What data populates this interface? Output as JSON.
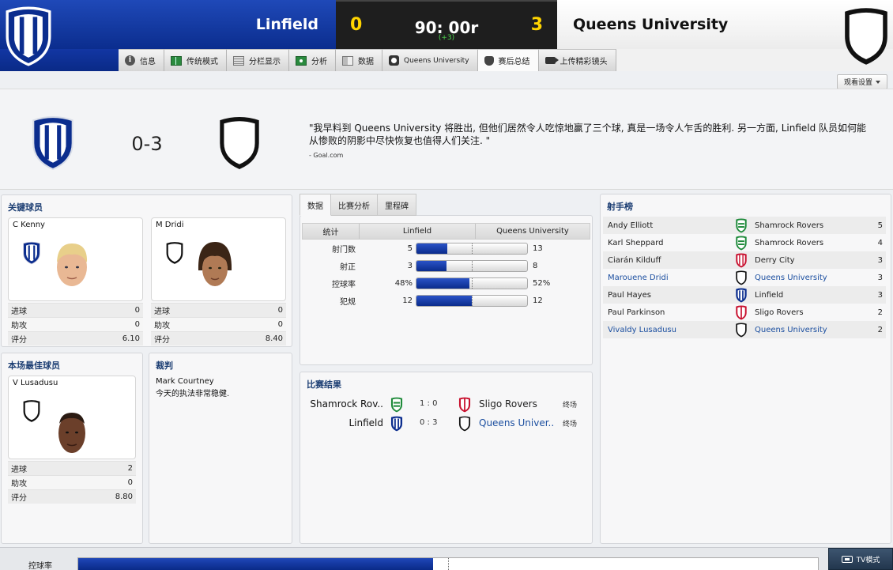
{
  "header": {
    "home_team": "Linfield",
    "away_team": "Queens University",
    "home_score": "0",
    "away_score": "3",
    "clock": "90: 00r",
    "added_time": "(+3)"
  },
  "tabs": [
    {
      "label": "信息",
      "icon": "info-icon"
    },
    {
      "label": "传统模式",
      "icon": "pitch-icon"
    },
    {
      "label": "分栏显示",
      "icon": "split-view-icon"
    },
    {
      "label": "分析",
      "icon": "analysis-icon"
    },
    {
      "label": "数据",
      "icon": "data-icon"
    },
    {
      "label": "Queens University",
      "icon": "club-icon"
    },
    {
      "label": "赛后总结",
      "icon": "shield-icon",
      "active": true
    },
    {
      "label": "上传精彩镜头",
      "icon": "camera-icon"
    }
  ],
  "view_settings": "观看设置",
  "summary": {
    "score": "0-3",
    "quote": "\"我早料到 Queens University 将胜出, 但他们居然令人吃惊地赢了三个球, 真是一场令人乍舌的胜利. 另一方面, Linfield 队员如何能从惨败的阴影中尽快恢复也值得人们关注. \"",
    "source": "- Goal.com"
  },
  "key_players": {
    "title": "关键球员",
    "players": [
      {
        "name": "C Kenny",
        "team": "home",
        "stats": [
          {
            "label": "进球",
            "value": "0"
          },
          {
            "label": "助攻",
            "value": "0"
          },
          {
            "label": "评分",
            "value": "6.10"
          }
        ]
      },
      {
        "name": "M Dridi",
        "team": "away",
        "stats": [
          {
            "label": "进球",
            "value": "0"
          },
          {
            "label": "助攻",
            "value": "0"
          },
          {
            "label": "评分",
            "value": "8.40"
          }
        ]
      }
    ]
  },
  "motm": {
    "title": "本场最佳球员",
    "name": "V Lusadusu",
    "stats": [
      {
        "label": "进球",
        "value": "2"
      },
      {
        "label": "助攻",
        "value": "0"
      },
      {
        "label": "评分",
        "value": "8.80"
      }
    ]
  },
  "referee": {
    "title": "裁判",
    "name": "Mark Courtney",
    "comment": "今天的执法非常稳健."
  },
  "stats_panel": {
    "subtabs": [
      "数据",
      "比赛分析",
      "里程碑"
    ],
    "headers": [
      "统计",
      "Linfield",
      "Queens University"
    ],
    "rows": [
      {
        "label": "射门数",
        "home": "5",
        "away": "13",
        "home_share": 0.278
      },
      {
        "label": "射正",
        "home": "3",
        "away": "8",
        "home_share": 0.273
      },
      {
        "label": "控球率",
        "home": "48%",
        "away": "52%",
        "home_share": 0.48
      },
      {
        "label": "犯规",
        "home": "12",
        "away": "12",
        "home_share": 0.5
      }
    ]
  },
  "results": {
    "title": "比赛结果",
    "rows": [
      {
        "home": "Shamrock Rov..",
        "home_club": "shamrock",
        "score": "1 : 0",
        "away": "Sligo Rovers",
        "away_club": "sligo",
        "status": "终场",
        "away_link": false
      },
      {
        "home": "Linfield",
        "home_club": "linfield",
        "score": "0 : 3",
        "away": "Queens Univer..",
        "away_club": "queens",
        "status": "终场",
        "away_link": true
      }
    ]
  },
  "scorers": {
    "title": "射手榜",
    "rows": [
      {
        "name": "Andy Elliott",
        "club": "Shamrock Rovers",
        "club_key": "shamrock",
        "goals": "5",
        "link": false
      },
      {
        "name": "Karl Sheppard",
        "club": "Shamrock Rovers",
        "club_key": "shamrock",
        "goals": "4",
        "link": false
      },
      {
        "name": "Ciarán Kilduff",
        "club": "Derry City",
        "club_key": "derry",
        "goals": "3",
        "link": false
      },
      {
        "name": "Marouene Dridi",
        "club": "Queens University",
        "club_key": "queens",
        "goals": "3",
        "link": true
      },
      {
        "name": "Paul Hayes",
        "club": "Linfield",
        "club_key": "linfield",
        "goals": "3",
        "link": false
      },
      {
        "name": "Paul Parkinson",
        "club": "Sligo Rovers",
        "club_key": "sligo",
        "goals": "2",
        "link": false
      },
      {
        "name": "Vivaldy Lusadusu",
        "club": "Queens University",
        "club_key": "queens",
        "goals": "2",
        "link": true
      }
    ]
  },
  "bottom": {
    "label": "控球率",
    "possession_home": 0.48,
    "tv_mode": "TV模式"
  },
  "colors": {
    "linfield_blue": "#0b2d8e",
    "score_yellow": "#ffd400",
    "added_green": "#4cd44c",
    "link_blue": "#1c4fa0"
  }
}
